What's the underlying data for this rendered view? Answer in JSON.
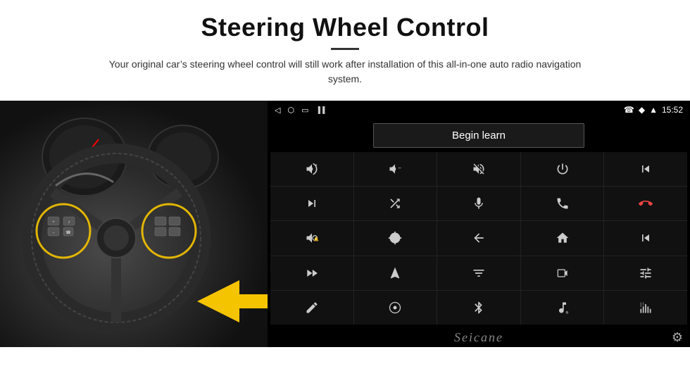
{
  "header": {
    "title": "Steering Wheel Control",
    "divider": true,
    "subtitle": "Your original car’s steering wheel control will still work after installation of this all-in-one auto radio navigation system."
  },
  "android_panel": {
    "status_bar": {
      "back_icon": "◁",
      "home_icon": "□",
      "recent_icon": "□",
      "signal_icon": "▐▐",
      "phone_icon": "☎",
      "location_icon": "◆",
      "wifi_icon": "▲",
      "time": "15:52"
    },
    "begin_learn_label": "Begin learn",
    "controls": [
      {
        "id": "vol-up",
        "icon": "vol+"
      },
      {
        "id": "vol-down",
        "icon": "vol-"
      },
      {
        "id": "mute",
        "icon": "mute"
      },
      {
        "id": "power",
        "icon": "power"
      },
      {
        "id": "prev-track",
        "icon": "prev"
      },
      {
        "id": "next-track",
        "icon": "next"
      },
      {
        "id": "shuffle",
        "icon": "shuffle"
      },
      {
        "id": "mic",
        "icon": "mic"
      },
      {
        "id": "phone",
        "icon": "phone"
      },
      {
        "id": "hang-up",
        "icon": "hangup"
      },
      {
        "id": "horn",
        "icon": "horn"
      },
      {
        "id": "360-cam",
        "icon": "360"
      },
      {
        "id": "back-nav",
        "icon": "back"
      },
      {
        "id": "home-nav",
        "icon": "home"
      },
      {
        "id": "skip-back",
        "icon": "skipback"
      },
      {
        "id": "fast-fwd",
        "icon": "fastfwd"
      },
      {
        "id": "navigate",
        "icon": "navigate"
      },
      {
        "id": "eq",
        "icon": "eq"
      },
      {
        "id": "record",
        "icon": "record"
      },
      {
        "id": "settings-eq",
        "icon": "settings-eq"
      },
      {
        "id": "pen",
        "icon": "pen"
      },
      {
        "id": "circle-menu",
        "icon": "circle-menu"
      },
      {
        "id": "bluetooth",
        "icon": "bluetooth"
      },
      {
        "id": "music-note",
        "icon": "music"
      },
      {
        "id": "levels",
        "icon": "levels"
      }
    ],
    "bottom": {
      "logo": "Seicane",
      "gear": "⚙"
    }
  }
}
